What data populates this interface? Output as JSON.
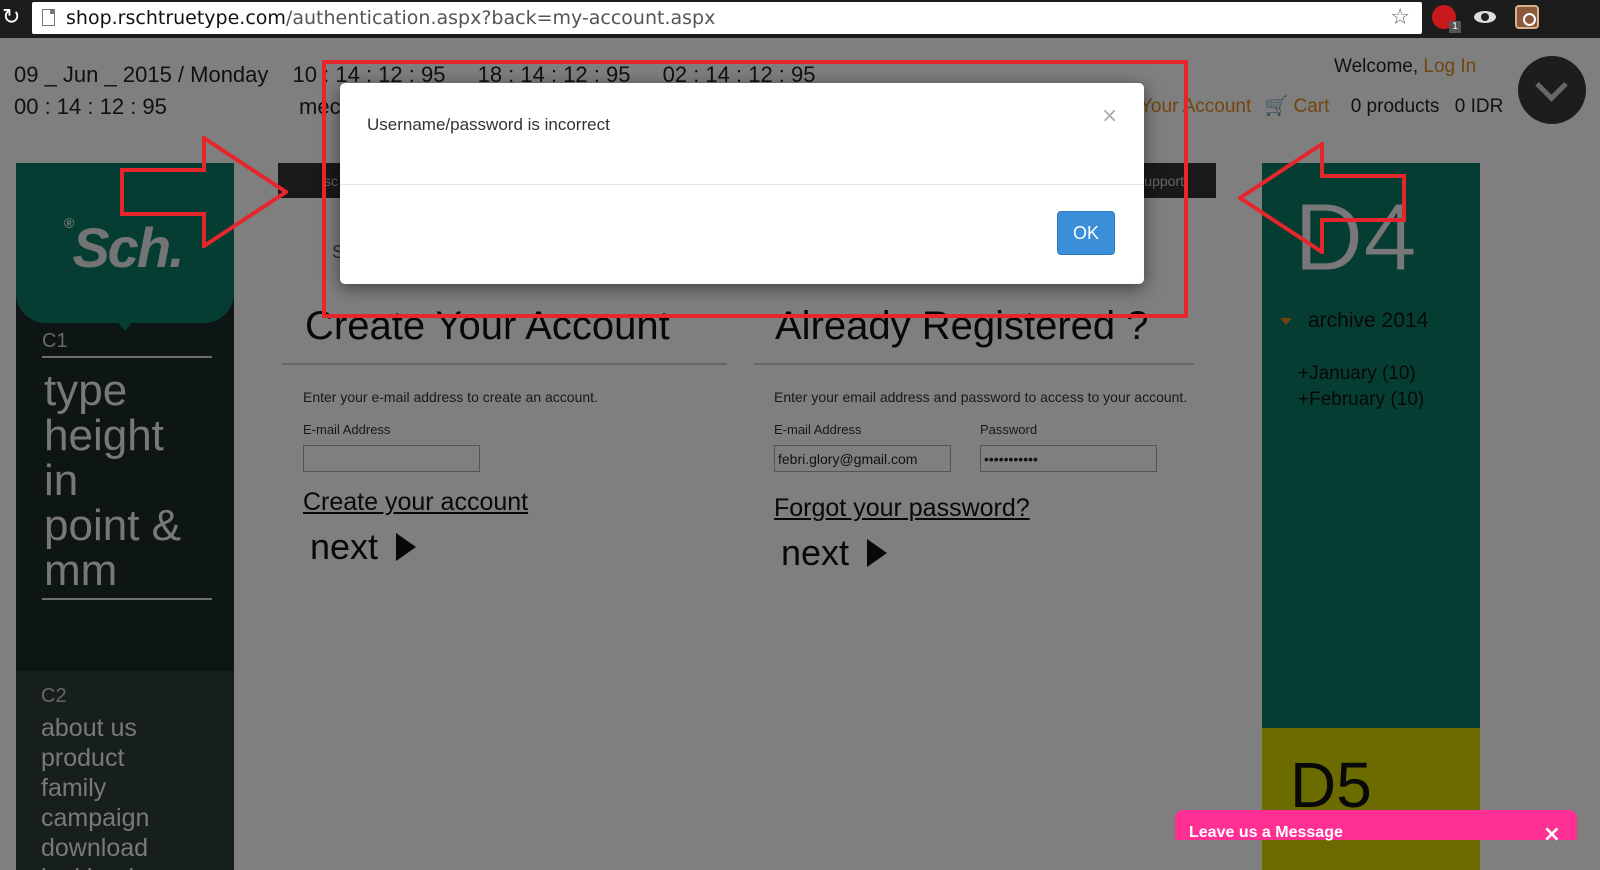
{
  "browser": {
    "url_host": "shop.rschtruetype.com",
    "url_path": "/authentication.aspx?back=my-account.aspx",
    "icons": [
      "reload-icon",
      "page-icon",
      "star-icon",
      "stop-extension-icon",
      "eye-extension-icon",
      "instagram-extension-icon"
    ]
  },
  "header": {
    "date_line1_a": "09 _ Jun _ 2015 / Monday",
    "date_line1_b": "10 : 14 : 12 : 95",
    "date_line1_c": "18 : 14 : 12 : 95",
    "date_line1_d": "02 : 14 : 12 : 95",
    "date_line2_a": "00 : 14 : 12 : 95",
    "date_line2_b": "meco",
    "welcome": "Welcome,",
    "login": "Log In",
    "your_account": "Your Account",
    "cart": "Cart",
    "products": "0 products",
    "amount": "0 IDR"
  },
  "sidebar": {
    "logo": "Sch.",
    "logo_mark": "®",
    "c1_label": "C1",
    "c1_lines": [
      "type",
      "height",
      "in",
      "point &",
      "mm"
    ],
    "c2_label": "C2",
    "menu": [
      "about us",
      "product",
      "family",
      "campaign",
      "download",
      "lookbook"
    ]
  },
  "topnav": {
    "left": "sc",
    "right": "upport",
    "search_fragment": "S"
  },
  "create": {
    "title": "Create Your Account",
    "hint": "Enter your e-mail address to create an account.",
    "email_label": "E-mail Address",
    "email_value": "",
    "link": "Create your account",
    "next": "next"
  },
  "login": {
    "title": "Already Registered ?",
    "hint": "Enter your email address and password to access to your account.",
    "email_label": "E-mail Address",
    "email_value": "febri.glory@gmail.com",
    "password_label": "Password",
    "password_value": "•••••••••••",
    "forgot": "Forgot your password?",
    "next": "next"
  },
  "right_column": {
    "d4": "D4",
    "archive": "archive 2014",
    "months": [
      "+January (10)",
      "+February (10)"
    ],
    "d5": "D5"
  },
  "chat": {
    "label": "Leave us a Message",
    "close": "×"
  },
  "modal": {
    "message": "Username/password is incorrect",
    "close": "×",
    "ok": "OK"
  },
  "colors": {
    "annotation_red": "#e6262d",
    "ok_blue": "#3a8fd8",
    "teal": "#0b7a66",
    "yellow": "#d6d600",
    "pink": "#ff2f93",
    "orange": "#e58a1e"
  }
}
